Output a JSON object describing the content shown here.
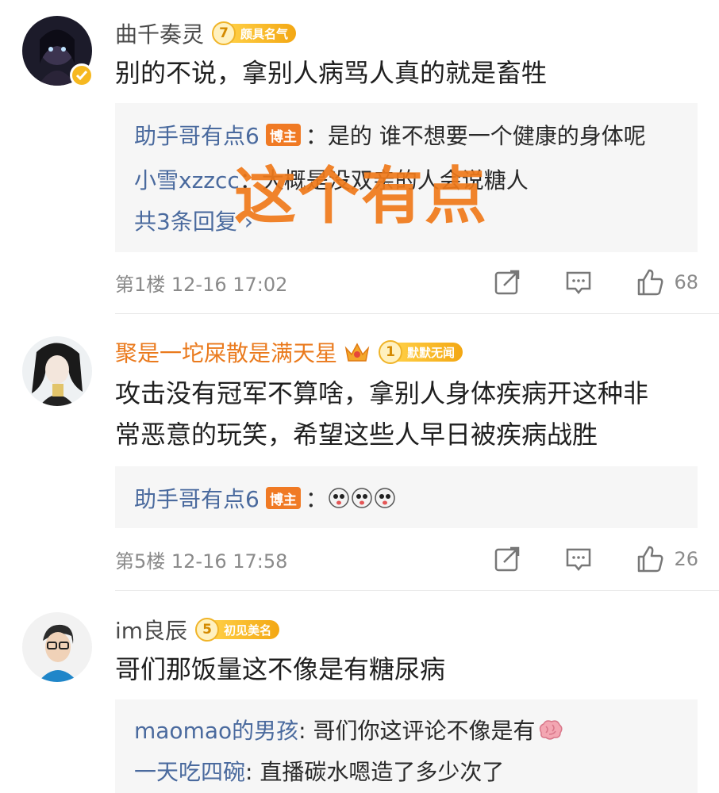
{
  "watermark": "这个有点",
  "comments": [
    {
      "username": "曲千奏灵",
      "badge_level": "7",
      "badge_title": "颇具名气",
      "text": "别的不说，拿别人病骂人真的就是畜牲",
      "replies": [
        {
          "user": "助手哥有点6",
          "host_tag": "博主",
          "text": "：是的   谁不想要一个健康的身体呢"
        },
        {
          "user": "小雪xzzcc",
          "text": "：大概是没双亲的人会说糖人"
        }
      ],
      "more_replies": "共3条回复 ›",
      "floor": "第1楼  12-16 17:02",
      "likes": "68"
    },
    {
      "username": "聚是一坨屎散是满天星",
      "badge_level": "1",
      "badge_title": "默默无闻",
      "text_lines": [
        "攻击没有冠军不算啥，拿别人身体疾病开这种非",
        "常恶意的玩笑，希望这些人早日被疾病战胜"
      ],
      "replies": [
        {
          "user": "助手哥有点6",
          "host_tag": "博主",
          "text": "："
        }
      ],
      "floor": "第5楼  12-16 17:58",
      "likes": "26"
    },
    {
      "username": "im良辰",
      "badge_level": "5",
      "badge_title": "初见美名",
      "text": "哥们那饭量这不像是有糖尿病",
      "replies": [
        {
          "user": "maomao的男孩",
          "text": ": 哥们你这评论不像是有"
        },
        {
          "user": "一天吃四碗",
          "text": ": 直播碳水嗯造了多少次了"
        }
      ]
    }
  ],
  "colors": {
    "reply_user": "#4a6a9e",
    "orange_user": "#ea7a1d",
    "host_tag": "#f07a24",
    "watermark": "#f07a1a"
  },
  "icons": [
    "share-icon",
    "comment-icon",
    "like-icon",
    "crown-icon",
    "verified-icon",
    "emoji-icon",
    "brain-icon"
  ]
}
